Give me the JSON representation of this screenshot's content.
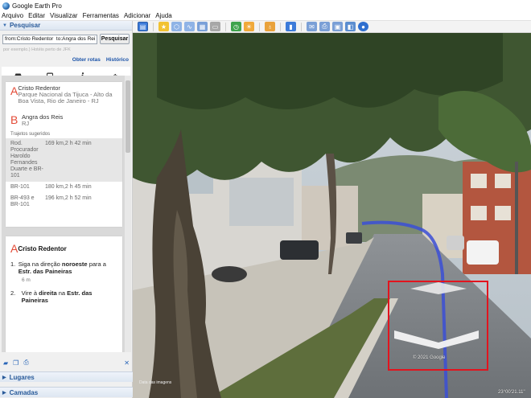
{
  "window": {
    "title": "Google Earth Pro"
  },
  "menu": [
    "Arquivo",
    "Editar",
    "Visualizar",
    "Ferramentas",
    "Adicionar",
    "Ajuda"
  ],
  "toolbar_icons": [
    "sidebar-icon",
    "placemark-icon",
    "polygon-icon",
    "path-icon",
    "image-overlay-icon",
    "record-tour-icon",
    "historical-imagery-icon",
    "sun-icon",
    "planets-icon",
    "ruler-icon",
    "email-icon",
    "print-icon",
    "save-image-icon",
    "maps-icon",
    "earth-gallery-icon"
  ],
  "search": {
    "header": "Pesquisar",
    "query": "from:Cristo Redentor  to:Angra dos Reis",
    "button": "Pesquisar",
    "hint": "por exemplo.) Hotéis perto de JFK",
    "links": {
      "routes": "Obter rotas",
      "history": "Histórico"
    }
  },
  "travel_modes": [
    "car-icon",
    "transit-icon",
    "walk-icon",
    "bike-icon"
  ],
  "directions": {
    "origin": {
      "letter": "A",
      "name": "Cristo Redentor",
      "address": "Parque Nacional da Tijuca - Alto da Boa Vista, Rio de Janeiro - RJ"
    },
    "destination": {
      "letter": "B",
      "name": "Angra dos Reis",
      "address": "RJ"
    },
    "routes_title": "Trajetos sugeridos",
    "routes": [
      {
        "name": "Rod. Procurador Haroldo Fernandes Duarte e BR-101",
        "info": "169 km,2 h 42 min",
        "selected": true
      },
      {
        "name": "BR-101",
        "info": "180 km,2 h 45 min",
        "selected": false
      },
      {
        "name": "BR-493 e BR-101",
        "info": "196 km,2 h 52 min",
        "selected": false
      }
    ],
    "step_header": {
      "letter": "A",
      "name": "Cristo Redentor"
    },
    "steps": [
      {
        "num": "1.",
        "pre": "Siga na direção",
        "bold1": "noroeste",
        "mid": "para a",
        "bold2": "Estr. das Paineiras",
        "dist": "6 m"
      },
      {
        "num": "2.",
        "pre": "Vire à",
        "bold1": "direita",
        "mid": "na",
        "bold2": "Estr. das Paineiras",
        "dist": ""
      }
    ]
  },
  "sections": {
    "places": "Lugares",
    "layers": "Camadas"
  },
  "view": {
    "copyright": "© 2021 Google",
    "coords": "23°00'21.11\"",
    "image_date": "Data das imagens"
  }
}
